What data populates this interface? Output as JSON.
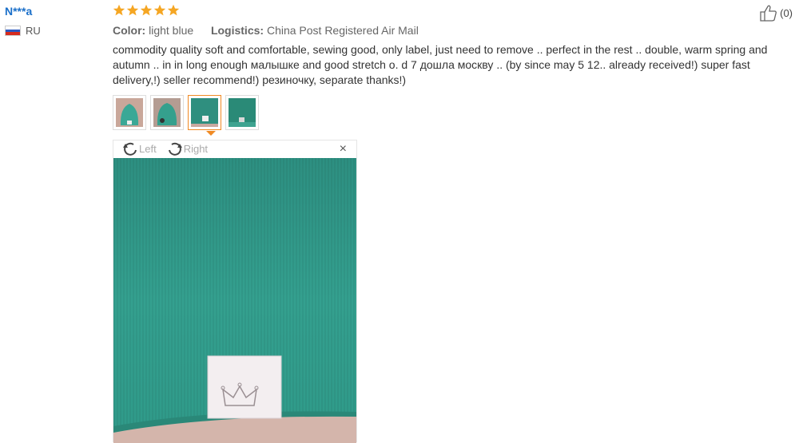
{
  "buyer": {
    "name": "N***a",
    "country": "RU",
    "flag_colors": [
      "#ffffff",
      "#2a58c0",
      "#d52b1e"
    ]
  },
  "review": {
    "rating": 5,
    "star_color": "#f5a623",
    "color_label": "Color:",
    "color_value": "light blue",
    "logistics_label": "Logistics:",
    "logistics_value": "China Post Registered Air Mail",
    "comment": "commodity quality soft and comfortable, sewing good, only label, just need to remove .. perfect in the rest .. double, warm spring and autumn .. in in long enough малышке and good stretch o. d 7 дошла москву .. (by since may 5 12.. already received!) super fast delivery,!) seller recommend!) резиночку, separate thanks!)"
  },
  "thumbnails": [
    {
      "name": "thumb-1",
      "active": false
    },
    {
      "name": "thumb-2",
      "active": false
    },
    {
      "name": "thumb-3",
      "active": true
    },
    {
      "name": "thumb-4",
      "active": false
    }
  ],
  "viewer": {
    "rotate_left": "Left",
    "rotate_right": "Right",
    "close": "×"
  },
  "helpful": {
    "count": "(0)"
  },
  "colors": {
    "accent": "#f08a24",
    "buyer_link": "#1a6fc9",
    "fabric": "#2f9e8c"
  }
}
